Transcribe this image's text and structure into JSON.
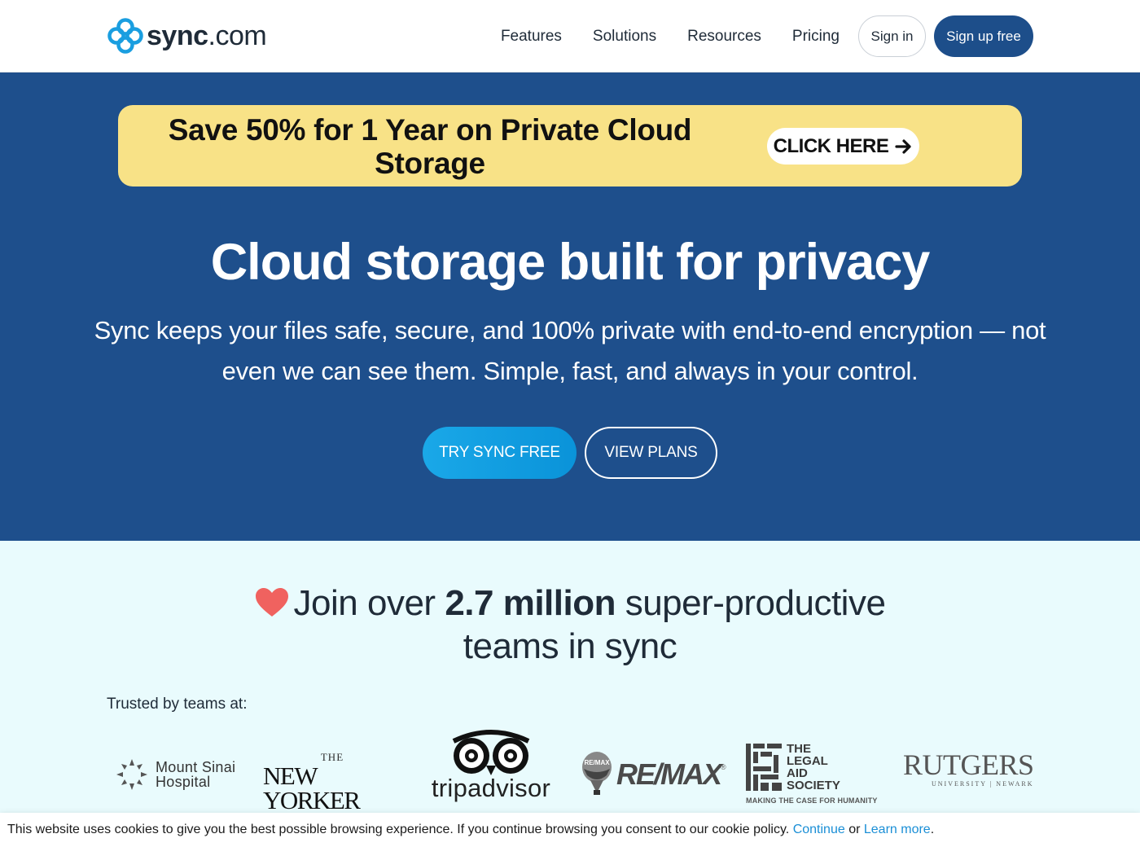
{
  "header": {
    "logo": {
      "brand_bold": "sync",
      "brand_light": ".com"
    },
    "nav": [
      "Features",
      "Solutions",
      "Resources",
      "Pricing"
    ],
    "sign_in": "Sign in",
    "sign_up": "Sign up free"
  },
  "promo": {
    "text": "Save 50% for 1 Year on Private Cloud Storage",
    "button": "CLICK HERE"
  },
  "hero": {
    "title": "Cloud storage built for privacy",
    "subtitle": "Sync keeps your files safe, secure, and 100% private with end-to-end encryption — not even we can see them. Simple, fast, and always in your control.",
    "primary_button": "TRY SYNC FREE",
    "secondary_button": "VIEW PLANS"
  },
  "proof": {
    "join_prefix": "Join over ",
    "join_bold": "2.7 million",
    "join_suffix": " super-productive teams in sync",
    "trusted_label": "Trusted by teams at:",
    "logos": {
      "sinai_line1": "Mount Sinai",
      "sinai_line2": "Hospital",
      "newyorker_the": "THE",
      "newyorker_name": "NEW YORKER",
      "tripadvisor": "tripadvisor",
      "remax": "RE/MAX",
      "remax_balloon": "RE/MAX",
      "legal_line1": "THE",
      "legal_line2": "LEGAL",
      "legal_line3": "AID",
      "legal_line4": "SOCIETY",
      "legal_tagline": "MAKING THE CASE FOR HUMANITY",
      "rutgers_name": "RUTGERS",
      "rutgers_sub": "UNIVERSITY | NEWARK"
    }
  },
  "cookie": {
    "text": "This website uses cookies to give you the best possible browsing experience. If you continue browsing you consent to our cookie policy.",
    "continue": "Continue",
    "or": "or",
    "learn_more": "Learn more",
    "period": "."
  },
  "colors": {
    "hero_bg": "#1e4f8c",
    "promo_bg": "#f8e287",
    "primary_btn": "#0a93d9",
    "proof_bg": "#e9fbfd",
    "heart": "#f0625f",
    "link": "#1b8fd6"
  }
}
